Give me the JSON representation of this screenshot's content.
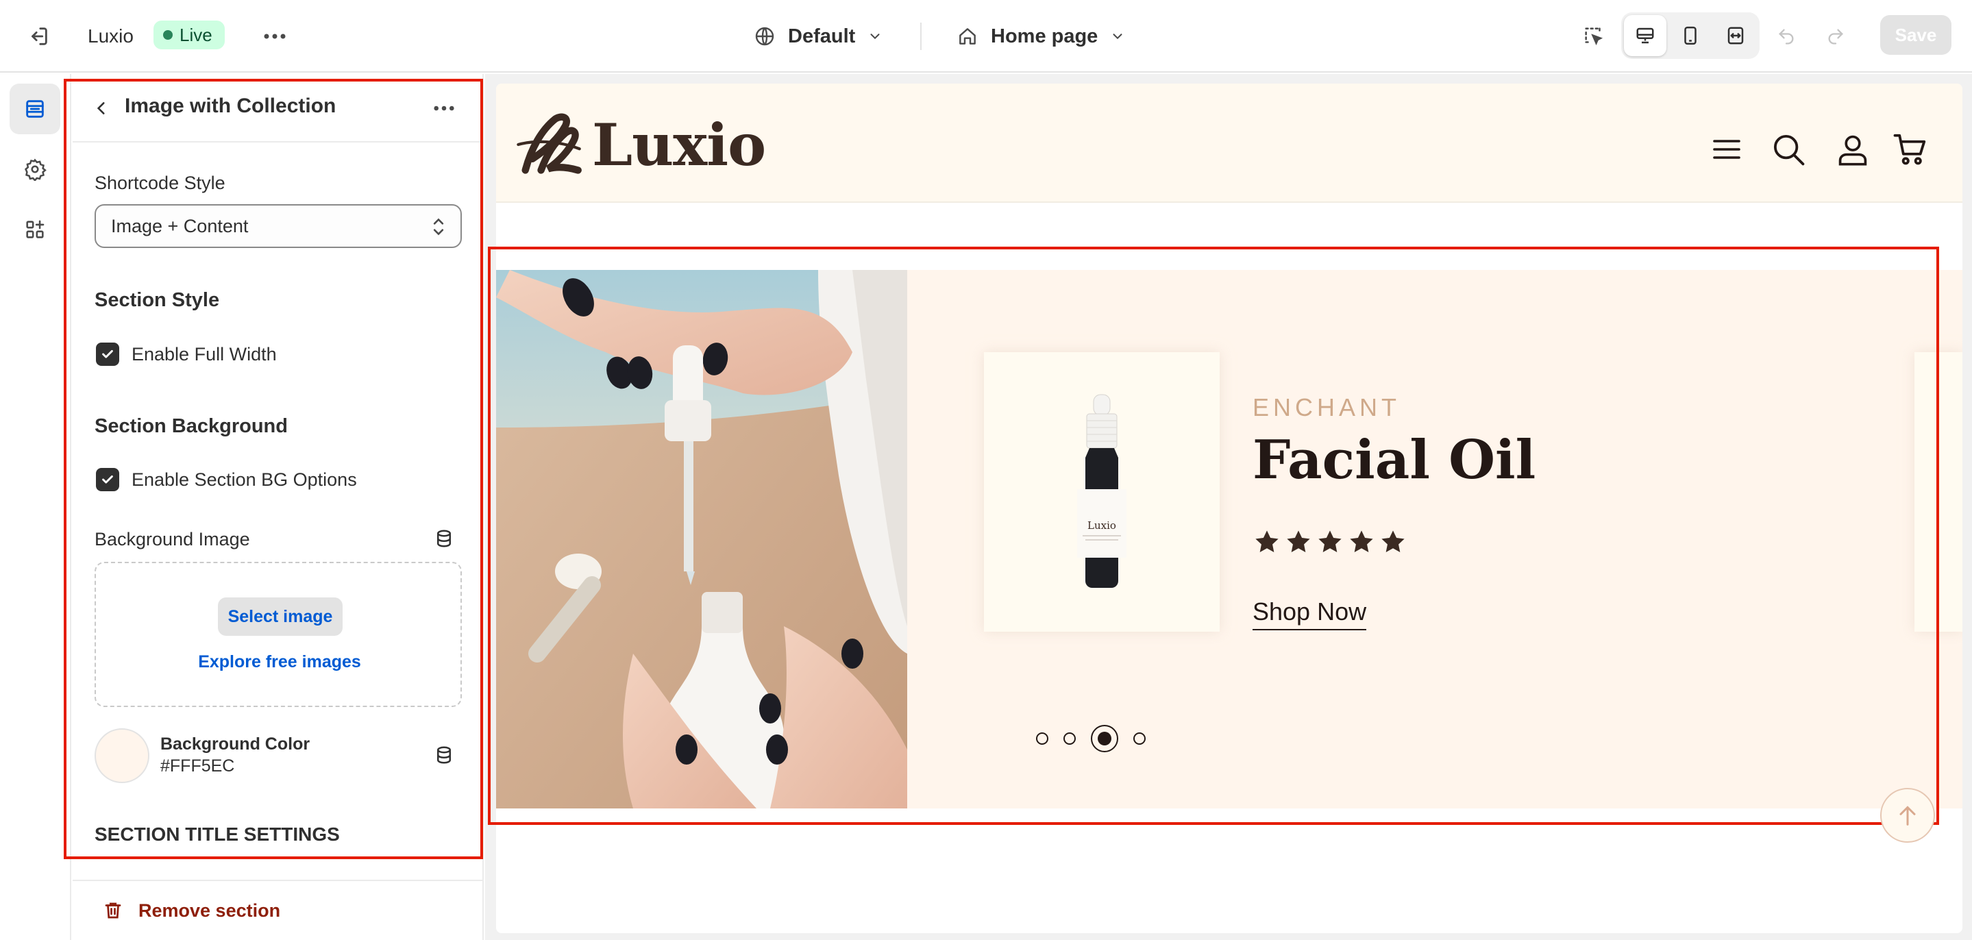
{
  "topbar": {
    "store_name": "Luxio",
    "live_label": "Live",
    "theme_label": "Default",
    "page_label": "Home page",
    "save_label": "Save"
  },
  "panel": {
    "title": "Image with Collection",
    "shortcode_label": "Shortcode Style",
    "shortcode_value": "Image + Content",
    "section_style_heading": "Section Style",
    "full_width_label": "Enable Full Width",
    "full_width_checked": true,
    "section_bg_heading": "Section Background",
    "bg_options_label": "Enable Section BG Options",
    "bg_options_checked": true,
    "bg_image_label": "Background Image",
    "select_image_label": "Select image",
    "explore_label": "Explore free images",
    "bg_color_label": "Background Color",
    "bg_color_value": "#FFF5EC",
    "title_settings_heading": "SECTION TITLE SETTINGS",
    "remove_label": "Remove section"
  },
  "preview": {
    "logo_text": "Luxio",
    "hero": {
      "subtitle": "ENCHANT",
      "title": "Facial Oil",
      "rating": 5,
      "cta": "Shop Now",
      "bottle_label": "Luxio",
      "slides_count": 4,
      "active_slide": 3
    }
  },
  "colors": {
    "accent_red": "#e51c00",
    "live_green": "#29845a",
    "link_blue": "#005bd3",
    "hero_bg": "#FFF5EC",
    "brand_brown": "#3b2a22",
    "danger": "#8e1f0b"
  },
  "icons": {
    "exit": "exit-icon",
    "more": "more-horizontal-icon",
    "globe": "globe-icon",
    "home": "home-icon",
    "inspect": "inspect-icon",
    "desktop": "desktop-icon",
    "mobile": "mobile-icon",
    "fullwidth": "full-width-icon",
    "undo": "undo-icon",
    "redo": "redo-icon",
    "sections": "sections-icon",
    "settings": "gear-icon",
    "apps": "apps-icon",
    "database": "database-icon",
    "trash": "trash-icon",
    "menu": "hamburger-icon",
    "search": "search-icon",
    "account": "user-icon",
    "cart": "cart-icon",
    "arrow_up": "arrow-up-icon"
  }
}
